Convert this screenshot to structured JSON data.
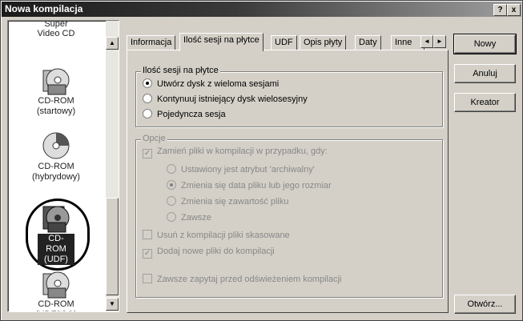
{
  "window": {
    "title": "Nowa kompilacja",
    "help_label": "?",
    "close_label": "x"
  },
  "list": {
    "items": [
      {
        "label": "Super Video CD",
        "icon": "super-video-cd-icon"
      },
      {
        "label": "CD-ROM (startowy)",
        "icon": "cd-rom-boot-icon"
      },
      {
        "label": "CD-ROM (hybrydowy)",
        "icon": "cd-rom-hybrid-icon"
      },
      {
        "label": "CD-ROM (UDF)",
        "icon": "cd-rom-udf-icon",
        "selected": true
      },
      {
        "label": "CD-ROM (UDF/ISO)",
        "icon": "cd-rom-udf-iso-icon"
      }
    ],
    "scroll_up": "▲",
    "scroll_down": "▼"
  },
  "tabs": {
    "items": [
      "Informacja",
      "Ilość sesji na płytce",
      "UDF",
      "Opis płyty",
      "Daty",
      "Inne"
    ],
    "active_index": 1,
    "prev": "◄",
    "next": "►"
  },
  "sessions": {
    "title": "Ilość sesji na płytce",
    "options": [
      "Utwórz dysk z wieloma sesjami",
      "Kontynuuj istniejący dysk wielosesyjny",
      "Pojedyncza sesja"
    ],
    "selected": 0
  },
  "options": {
    "title": "Opcje",
    "replace_label": "Zamień pliki w kompilacji w przypadku, gdy:",
    "replace_checked": true,
    "replace_conditions": [
      "Ustawiony jest atrybut 'archiwalny'",
      "Zmienia się data pliku lub jego rozmiar",
      "Zmienia się zawartość pliku",
      "Zawsze"
    ],
    "replace_selected": 1,
    "remove_deleted_label": "Usuń z kompilacji pliki skasowane",
    "remove_deleted_checked": false,
    "add_new_label": "Dodaj nowe pliki do kompilacji",
    "add_new_checked": true,
    "always_ask_label": "Zawsze zapytaj przed odświeżeniem kompilacji",
    "always_ask_checked": false
  },
  "buttons": {
    "new": "Nowy",
    "cancel": "Anuluj",
    "wizard": "Kreator",
    "open": "Otwórz..."
  }
}
